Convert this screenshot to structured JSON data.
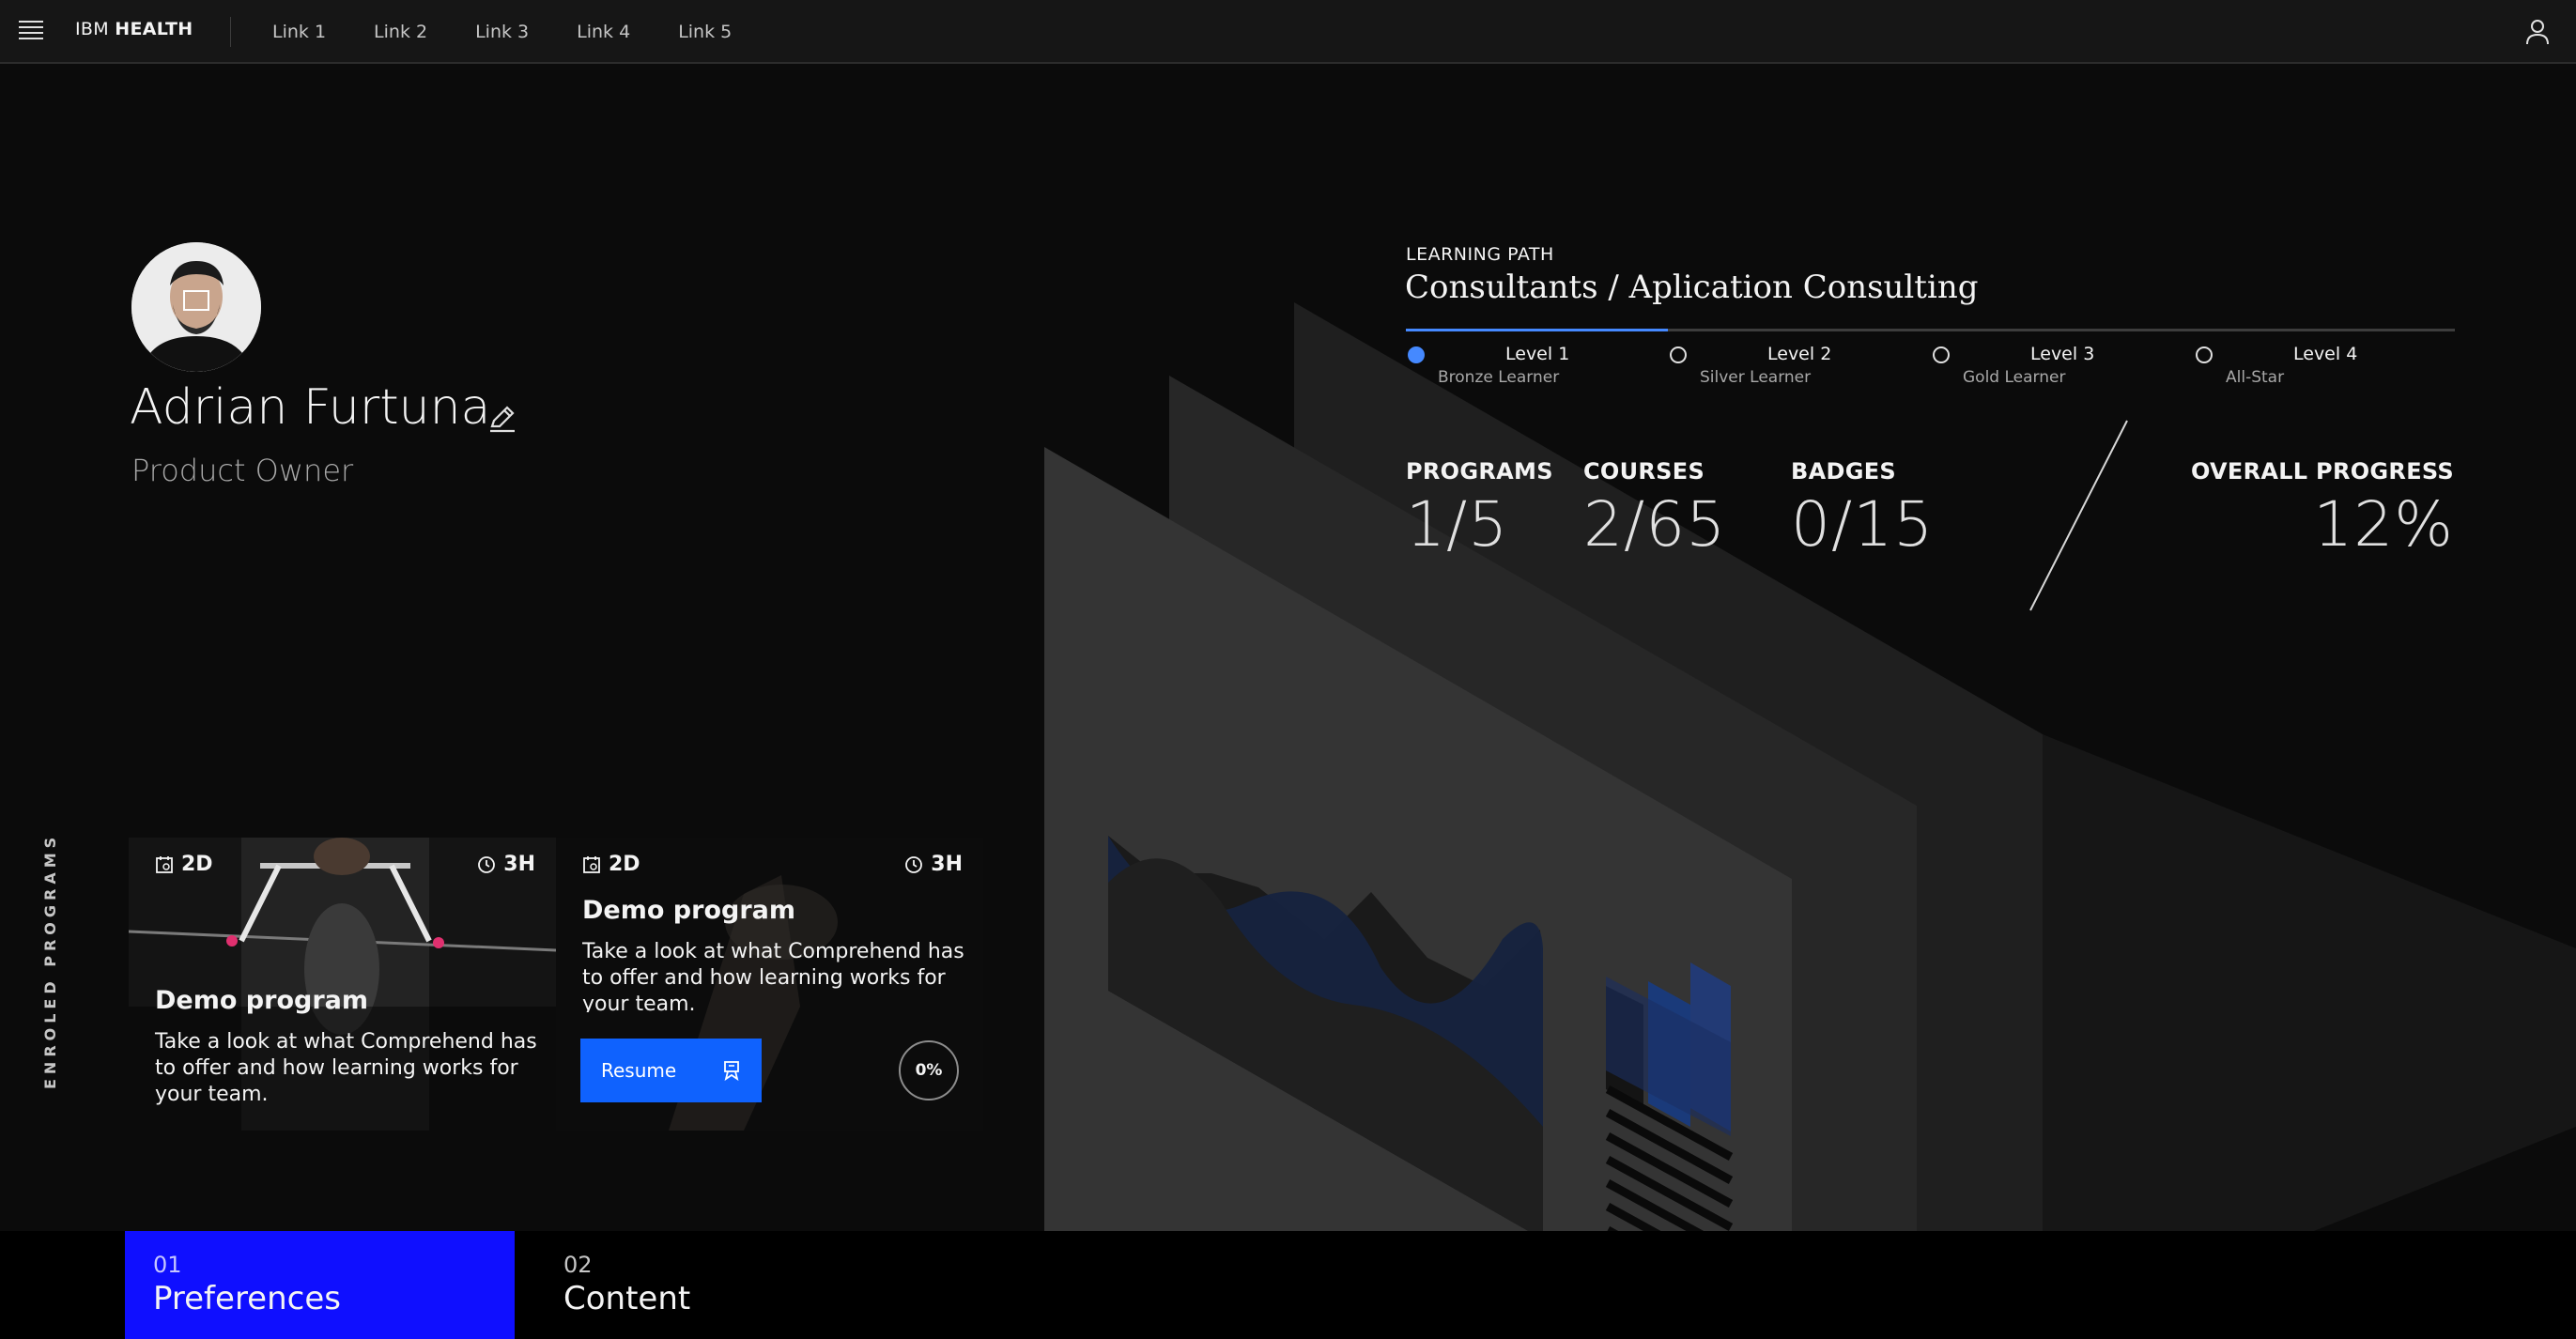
{
  "header": {
    "brand_prefix": "IBM",
    "brand_name": "HEALTH",
    "links": [
      "Link 1",
      "Link 2",
      "Link 3",
      "Link 4",
      "Link 5"
    ],
    "menu_icon": "hamburger-menu-icon",
    "user_icon": "user-icon"
  },
  "profile": {
    "name": "Adrian Furtuna",
    "role": "Product Owner",
    "edit_icon": "pencil-icon"
  },
  "learning_path": {
    "eyebrow": "LEARNING PATH",
    "title": "Consultants / Aplication Consulting",
    "progress_fraction": 0.25,
    "levels": [
      {
        "name": "Level 1",
        "subtitle": "Bronze Learner",
        "active": true
      },
      {
        "name": "Level 2",
        "subtitle": "Silver Learner",
        "active": false
      },
      {
        "name": "Level 3",
        "subtitle": "Gold Learner",
        "active": false
      },
      {
        "name": "Level 4",
        "subtitle": "All-Star",
        "active": false
      }
    ]
  },
  "stats": {
    "programs": {
      "label": "PROGRAMS",
      "value": "1/5"
    },
    "courses": {
      "label": "COURSES",
      "value": "2/65"
    },
    "badges": {
      "label": "BADGES",
      "value": "0/15"
    },
    "overall": {
      "label": "OVERALL PROGRESS",
      "value": "12%"
    }
  },
  "enrolled": {
    "label": "ENROLED PROGRAMS",
    "cards": [
      {
        "days": "2D",
        "hours": "3H",
        "title": "Demo program",
        "description": "Take a look at what Comprehend has to offer and how learning works for your team."
      },
      {
        "days": "2D",
        "hours": "3H",
        "title": "Demo program",
        "description": "Take a look at what Comprehend has to offer and how learning works for your team.",
        "button_label": "Resume",
        "progress": "0%"
      }
    ]
  },
  "tabs": [
    {
      "number": "01",
      "label": "Preferences",
      "active": true
    },
    {
      "number": "02",
      "label": "Content",
      "active": false
    }
  ],
  "colors": {
    "accent_blue": "#0f62fe",
    "active_tab": "#0f0fff",
    "level_active": "#4589ff",
    "background": "#0b0b0b",
    "topbar": "#161616"
  }
}
